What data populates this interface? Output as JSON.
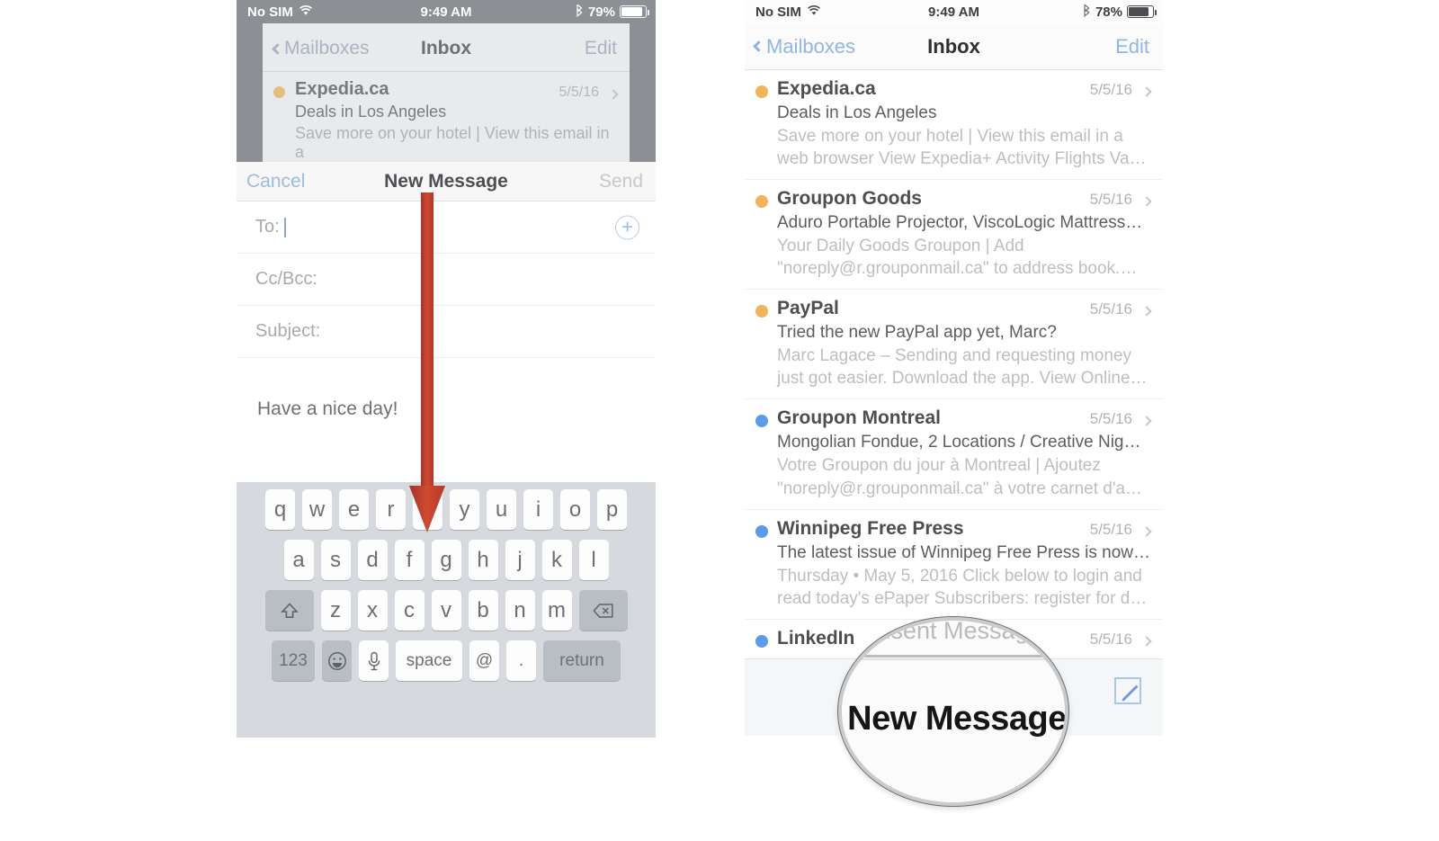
{
  "left_phone": {
    "status_bar": {
      "carrier": "No SIM",
      "wifi_icon": "wifi-icon",
      "time": "9:49 AM",
      "bluetooth_icon": "bluetooth-icon",
      "battery_percent": "79%"
    },
    "inbox_nav": {
      "back_label": "Mailboxes",
      "title": "Inbox",
      "edit_label": "Edit"
    },
    "inbox_row": {
      "sender": "Expedia.ca",
      "date": "5/5/16",
      "subject": "Deals in Los Angeles",
      "preview": "Save more on your hotel | View this email in a"
    },
    "compose": {
      "cancel_label": "Cancel",
      "title": "New Message",
      "send_label": "Send",
      "to_label": "To:",
      "to_value": "",
      "cc_label": "Cc/Bcc:",
      "cc_value": "",
      "subject_label": "Subject:",
      "subject_value": "",
      "body_text": "Have a nice day!",
      "add_contact_icon": "plus-circle-icon"
    },
    "keyboard": {
      "row1": [
        "q",
        "w",
        "e",
        "r",
        "t",
        "y",
        "u",
        "i",
        "o",
        "p"
      ],
      "row2": [
        "a",
        "s",
        "d",
        "f",
        "g",
        "h",
        "j",
        "k",
        "l"
      ],
      "row3_shift": "shift-icon",
      "row3": [
        "z",
        "x",
        "c",
        "v",
        "b",
        "n",
        "m"
      ],
      "row3_delete": "delete-icon",
      "row4": [
        "123",
        "emoji-icon",
        "microphone-icon",
        "space",
        "@",
        ".",
        "return"
      ],
      "num_label": "123",
      "space_label": "space",
      "at_label": "@",
      "period_label": ".",
      "return_label": "return"
    },
    "annotation": {
      "arrow_icon": "down-arrow-icon",
      "arrow_color": "#bd3d2c"
    }
  },
  "right_phone": {
    "status_bar": {
      "carrier": "No SIM",
      "wifi_icon": "wifi-icon",
      "time": "9:49 AM",
      "bluetooth_icon": "bluetooth-icon",
      "battery_percent": "78%"
    },
    "nav": {
      "back_label": "Mailboxes",
      "title": "Inbox",
      "edit_label": "Edit"
    },
    "emails": [
      {
        "sender": "Expedia.ca",
        "date": "5/5/16",
        "subject": "Deals in Los Angeles",
        "preview": "Save more on your hotel | View this email in a web browser View Expedia+ Activity Flights Va…",
        "unread_color": "#f0b459"
      },
      {
        "sender": "Groupon Goods",
        "date": "5/5/16",
        "subject": "Aduro Portable Projector, ViscoLogic Mattress…",
        "preview": "Your Daily Goods Groupon | Add \"noreply@r.grouponmail.ca\" to address book.…",
        "unread_color": "#f0b459"
      },
      {
        "sender": "PayPal",
        "date": "5/5/16",
        "subject": "Tried the new PayPal app yet, Marc?",
        "preview": "Marc Lagace – Sending and requesting money just got easier. Download the app. View Online…",
        "unread_color": "#f0b459"
      },
      {
        "sender": "Groupon Montreal",
        "date": "5/5/16",
        "subject": "Mongolian Fondue, 2 Locations / Creative Nig…",
        "preview": "Votre Groupon du jour à Montreal | Ajoutez \"noreply@r.grouponmail.ca\" à votre carnet d'a…",
        "unread_color": "#5b9bec"
      },
      {
        "sender": "Winnipeg Free Press",
        "date": "5/5/16",
        "subject": "The latest issue of Winnipeg Free Press is now…",
        "preview": "Thursday • May 5, 2016 Click below to login and read today's ePaper Subscribers: register for d…",
        "unread_color": "#5b9bec"
      },
      {
        "sender": "LinkedIn",
        "date": "5/5/16",
        "subject": "",
        "preview": "",
        "unread_color": "#5b9bec"
      }
    ],
    "toolbar": {
      "compose_icon": "compose-pencil-icon"
    }
  },
  "magnifier": {
    "ghost_text": "nsent Message",
    "label": "New Message"
  }
}
